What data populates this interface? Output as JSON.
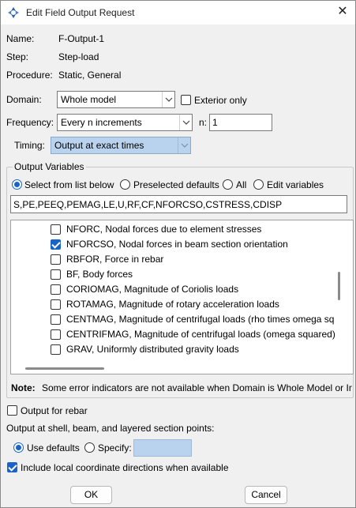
{
  "dialog": {
    "title": "Edit Field Output Request"
  },
  "info": {
    "name_label": "Name:",
    "name_value": "F-Output-1",
    "step_label": "Step:",
    "step_value": "Step-load",
    "procedure_label": "Procedure:",
    "procedure_value": "Static, General"
  },
  "domain": {
    "label": "Domain:",
    "value": "Whole model",
    "exterior_only_label": "Exterior only",
    "exterior_only_checked": false
  },
  "frequency": {
    "label": "Frequency:",
    "value": "Every n increments",
    "n_label": "n:",
    "n_value": "1"
  },
  "timing": {
    "label": "Timing:",
    "value": "Output at exact times"
  },
  "output_variables": {
    "group_label": "Output Variables",
    "options": [
      {
        "label": "Select from list below",
        "selected": true
      },
      {
        "label": "Preselected defaults",
        "selected": false
      },
      {
        "label": "All",
        "selected": false
      },
      {
        "label": "Edit variables",
        "selected": false
      }
    ],
    "variables_text": "S,PE,PEEQ,PEMAG,LE,U,RF,CF,NFORCSO,CSTRESS,CDISP",
    "items": [
      {
        "label": "NFORC, Nodal forces due to element stresses",
        "checked": false
      },
      {
        "label": "NFORCSO, Nodal forces in beam section orientation",
        "checked": true
      },
      {
        "label": "RBFOR, Force in rebar",
        "checked": false
      },
      {
        "label": "BF, Body forces",
        "checked": false
      },
      {
        "label": "CORIOMAG, Magnitude of Coriolis loads",
        "checked": false
      },
      {
        "label": "ROTAMAG, Magnitude of rotary acceleration loads",
        "checked": false
      },
      {
        "label": "CENTMAG, Magnitude of centrifugal loads (rho times omega sq",
        "checked": false
      },
      {
        "label": "CENTRIFMAG, Magnitude of centrifugal loads (omega squared)",
        "checked": false
      },
      {
        "label": "GRAV, Uniformly distributed gravity loads",
        "checked": false
      }
    ],
    "note_label": "Note:",
    "note_text": "Some error indicators are not available when Domain is Whole Model or Int"
  },
  "rebar": {
    "label": "Output for rebar",
    "checked": false
  },
  "section_points": {
    "label": "Output at shell, beam, and layered section points:",
    "use_defaults_label": "Use defaults",
    "use_defaults_selected": true,
    "specify_label": "Specify:",
    "specify_selected": false
  },
  "local_coords": {
    "label": "Include local coordinate directions when available",
    "checked": true
  },
  "buttons": {
    "ok": "OK",
    "cancel": "Cancel"
  },
  "colors": {
    "accent": "#1a64c8",
    "highlight": "#b9d3ee"
  }
}
